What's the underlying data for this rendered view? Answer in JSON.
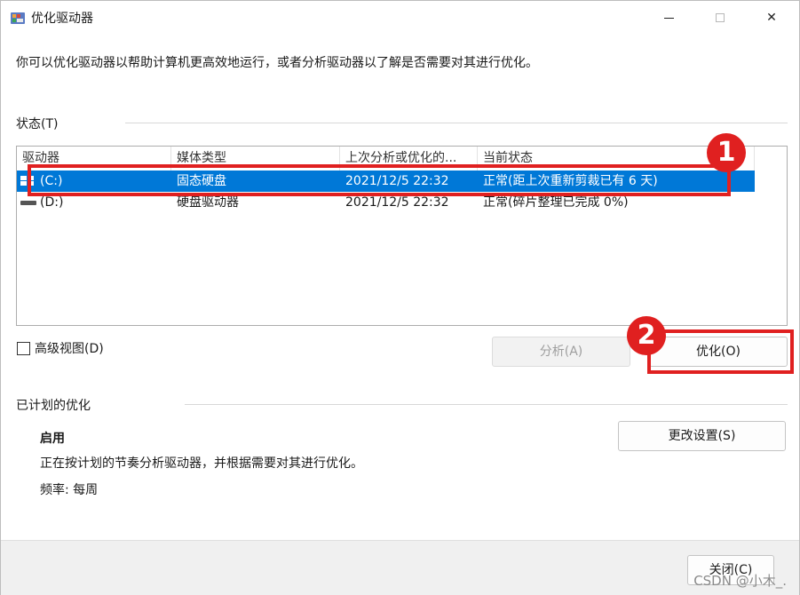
{
  "window": {
    "title": "优化驱动器",
    "icon": "defrag-app-icon",
    "minimize_glyph": "—",
    "close_glyph": "✕"
  },
  "intro_text": "你可以优化驱动器以帮助计算机更高效地运行，或者分析驱动器以了解是否需要对其进行优化。",
  "status_section": {
    "label": "状态(T)",
    "columns": [
      "驱动器",
      "媒体类型",
      "上次分析或优化的...",
      "当前状态"
    ],
    "rows": [
      {
        "drive": "(C:)",
        "media": "固态硬盘",
        "last": "2021/12/5 22:32",
        "status": "正常(距上次重新剪裁已有 6 天)",
        "selected": true,
        "icon": "windows-drive-icon"
      },
      {
        "drive": "(D:)",
        "media": "硬盘驱动器",
        "last": "2021/12/5 22:32",
        "status": "正常(碎片整理已完成 0%)",
        "selected": false,
        "icon": "hard-drive-icon"
      }
    ]
  },
  "advanced_view_label": "高级视图(D)",
  "buttons": {
    "analyze": "分析(A)",
    "optimize": "优化(O)",
    "change_settings": "更改设置(S)",
    "close": "关闭(C)"
  },
  "scheduled_section": {
    "label": "已计划的优化",
    "state": "启用",
    "description": "正在按计划的节奏分析驱动器，并根据需要对其进行优化。",
    "frequency": "频率: 每周"
  },
  "annotations": {
    "badge1": "1",
    "badge2": "2",
    "color": "#e02020"
  },
  "watermark": "CSDN @小木_.",
  "colors": {
    "selection": "#0078d7"
  }
}
